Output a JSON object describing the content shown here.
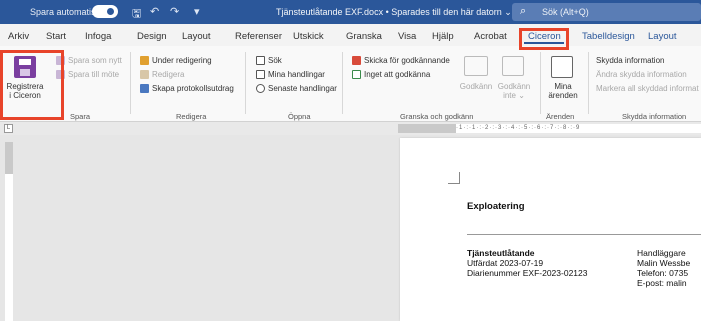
{
  "titlebar": {
    "autosave_label": "Spara automatiskt",
    "document_title": "Tjänsteutlåtande EXF.docx • Sparades till den här datorn ⌄",
    "search_placeholder": "Sök (Alt+Q)"
  },
  "tabs": [
    "Arkiv",
    "Start",
    "Infoga",
    "Design",
    "Layout",
    "Referenser",
    "Utskick",
    "Granska",
    "Visa",
    "Hjälp",
    "Acrobat",
    "Ciceron",
    "Tabelldesign",
    "Layout"
  ],
  "active_tab": "Ciceron",
  "ribbon": {
    "spara": {
      "register_label_1": "Registrera",
      "register_label_2": "i Ciceron",
      "save_as_new": "Spara som nytt",
      "save_to_mote": "Spara till möte",
      "group_label": "Spara"
    },
    "redigera": {
      "under_redigering": "Under redigering",
      "redigera": "Redigera",
      "skapa_protokoll": "Skapa protokollsutdrag",
      "group_label": "Redigera"
    },
    "oppna": {
      "sok": "Sök",
      "mina_handlingar": "Mina handlingar",
      "senaste_handlingar": "Senaste handlingar",
      "group_label": "Öppna"
    },
    "granska": {
      "skicka": "Skicka för godkännande",
      "inget_att": "Inget att godkänna",
      "godkann": "Godkänn",
      "godkann_inte_1": "Godkänn",
      "godkann_inte_2": "inte ⌄",
      "group_label": "Granska och godkänn"
    },
    "arenden": {
      "mina_1": "Mina",
      "mina_2": "ärenden",
      "group_label": "Ärenden"
    },
    "skydda": {
      "skydda_info": "Skydda information",
      "andra_skydda": "Ändra skydda information",
      "markera_all": "Markera all skyddad informat",
      "group_label": "Skydda information"
    }
  },
  "document": {
    "heading": "Exploatering",
    "left_col": [
      "Tjänsteutlåtande",
      "Utfärdat 2023-07-19",
      "Diarienummer EXF-2023-02123"
    ],
    "right_col": [
      "Handläggare",
      "Malin Wessbe",
      "Telefon: 0735",
      "E-post: malin"
    ]
  },
  "colors": {
    "titlebar": "#2b579a",
    "highlight": "#e8442a",
    "save_icon": "#7b3fa0"
  }
}
